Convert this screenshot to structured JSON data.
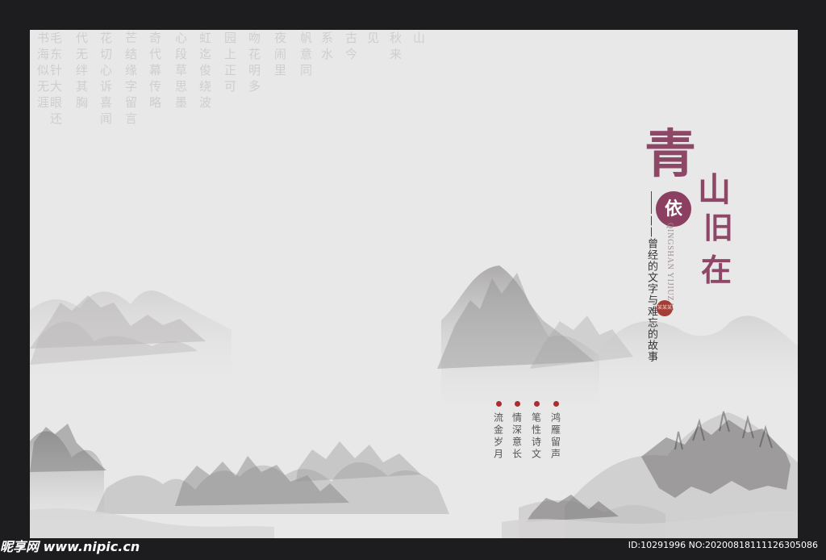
{
  "calligraphy": {
    "columns": [
      "书海似无涯",
      "毛东针大眼还",
      "代无绊其胸",
      "花切心诉喜闻",
      "芒结缘字留言",
      "奇代幕传略",
      "心段草思墨",
      "虹迄俊绕波",
      "园上正可",
      "吻花明多",
      "夜闹里",
      "帆意同",
      "系水",
      "古今",
      "见",
      "秋来",
      "山"
    ]
  },
  "title": {
    "chars": [
      "青",
      "山",
      "依",
      "旧",
      "在"
    ]
  },
  "pinyin": "QINGSHAN YIJIUZAI",
  "subtitle": "——曾经的文字与难忘的故事",
  "seal": "某某某",
  "quotes": [
    "鸿雁留声",
    "笔性诗文",
    "情深意长",
    "流金岁月"
  ],
  "footer": {
    "brand": "昵享网 www.nipic.cn",
    "id_info": "ID:10291996 NO:20200818111126305086"
  },
  "colors": {
    "background": "#1d1d1f",
    "paper": "#e9e8e8",
    "title": "#8f4768",
    "seal": "#ab2f32"
  }
}
